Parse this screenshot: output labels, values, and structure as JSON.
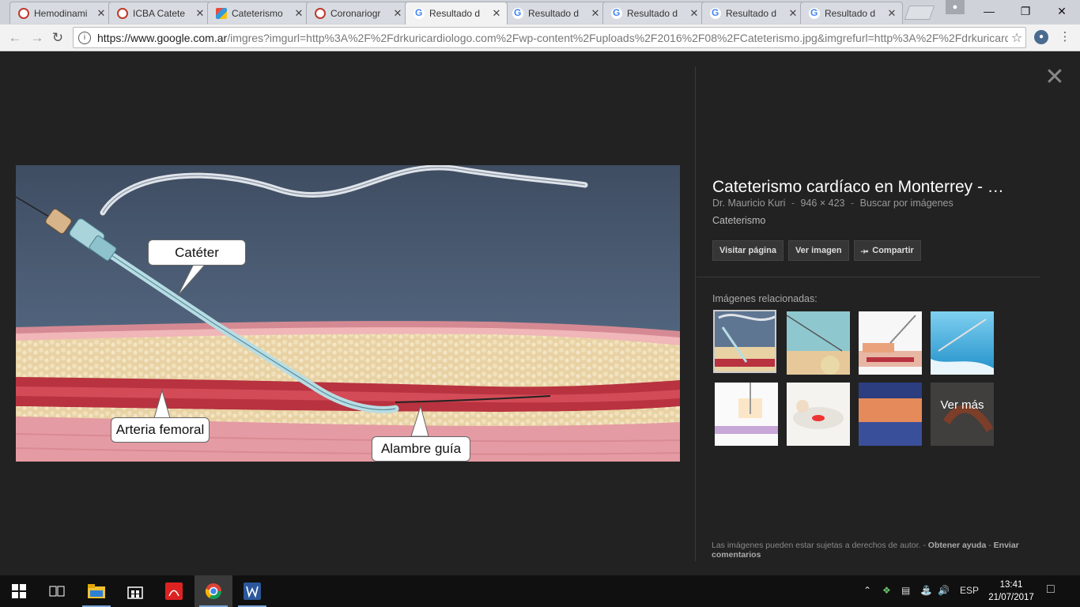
{
  "browser": {
    "tabs": [
      {
        "label": "Hemodinami",
        "favicon": "site-icon",
        "active": false
      },
      {
        "label": "ICBA Catete",
        "favicon": "site-icon",
        "active": false
      },
      {
        "label": "Cateterismo",
        "favicon": "doc-icon",
        "active": false
      },
      {
        "label": "Coronariogr",
        "favicon": "site-icon",
        "active": false
      },
      {
        "label": "Resultado d",
        "favicon": "google-icon",
        "active": true
      },
      {
        "label": "Resultado d",
        "favicon": "google-icon",
        "active": false
      },
      {
        "label": "Resultado d",
        "favicon": "google-icon",
        "active": false
      },
      {
        "label": "Resultado d",
        "favicon": "google-icon",
        "active": false
      },
      {
        "label": "Resultado d",
        "favicon": "google-icon",
        "active": false
      }
    ],
    "url_host": "https://www.google.com.ar",
    "url_path": "/imgres?imgurl=http%3A%2F%2Fdrkuricardiologo.com%2Fwp-content%2Fuploads%2F2016%2F08%2FCateterismo.jpg&imgrefurl=http%3A%2F%2Fdrkuricardi",
    "window_buttons": {
      "minimize": "—",
      "maximize": "❐",
      "close": "✕"
    }
  },
  "viewer": {
    "image_labels": {
      "cateter": "Catéter",
      "arteria": "Arteria femoral",
      "alambre": "Alambre guía"
    },
    "close_symbol": "✕"
  },
  "panel": {
    "title": "Cateterismo cardíaco en Monterrey - …",
    "source": "Dr. Mauricio Kuri",
    "dimensions": "946 × 423",
    "search_by_image": "Buscar por imágenes",
    "separator": "-",
    "caption": "Cateterismo",
    "buttons": {
      "visit": "Visitar página",
      "view": "Ver imagen",
      "share": "Compartir"
    },
    "related_label": "Imágenes relacionadas:",
    "more_label": "Ver más",
    "footer": {
      "copyright": "Las imágenes pueden estar sujetas a derechos de autor.",
      "help": "Obtener ayuda",
      "feedback": "Enviar comentarios",
      "sep": "-"
    }
  },
  "taskbar": {
    "language": "ESP",
    "time": "13:41",
    "date": "21/07/2017"
  },
  "colors": {
    "background": "#222222",
    "panel_text": "#ffffff",
    "muted_text": "#9a9a9a",
    "taskbar": "#101010"
  }
}
